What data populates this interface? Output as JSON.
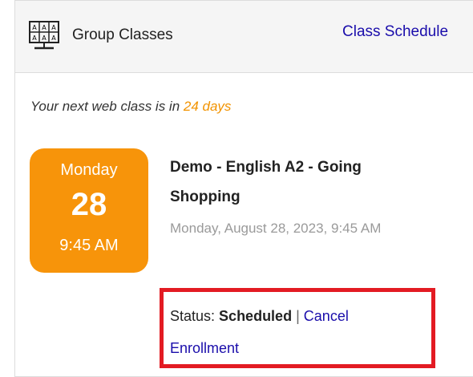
{
  "header": {
    "title": "Group Classes",
    "schedule_link": "Class Schedule",
    "icon": "classroom-icon"
  },
  "next_class": {
    "prefix": "Your next web class is in",
    "days": "24 days"
  },
  "badge": {
    "day": "Monday",
    "date": "28",
    "time": "9:45 AM",
    "color": "#f7940a"
  },
  "class": {
    "title": "Demo - English A2 - Going Shopping",
    "datetime": "Monday, August 28, 2023, 9:45 AM"
  },
  "status": {
    "label": "Status:",
    "value": "Scheduled",
    "separator": "|",
    "cancel_link": "Cancel Enrollment"
  },
  "colors": {
    "accent_orange": "#f7940a",
    "link_blue": "#1a0dab",
    "highlight_red": "#e31b23"
  }
}
